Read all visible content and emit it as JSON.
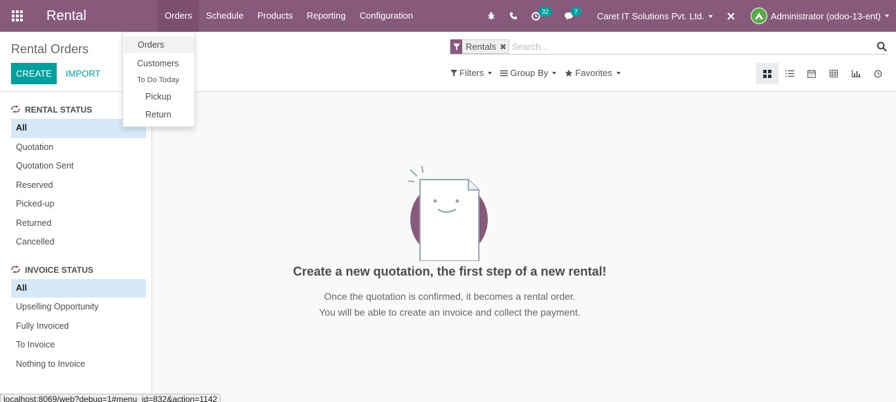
{
  "navbar": {
    "brand": "Rental",
    "menu": [
      "Orders",
      "Schedule",
      "Products",
      "Reporting",
      "Configuration"
    ],
    "activities_count": "32",
    "messages_count": "7",
    "company": "Caret IT Solutions Pvt. Ltd.",
    "user": "Administrator (odoo-13-ent)"
  },
  "control_panel": {
    "breadcrumb": "Rental Orders",
    "create_label": "Create",
    "import_label": "Import",
    "facet_label": "Rentals",
    "search_placeholder": "Search...",
    "filters_label": "Filters",
    "groupby_label": "Group By",
    "favorites_label": "Favorites"
  },
  "sidebar": {
    "rental_status": {
      "header": "Rental Status",
      "items": [
        "All",
        "Quotation",
        "Quotation Sent",
        "Reserved",
        "Picked-up",
        "Returned",
        "Cancelled"
      ]
    },
    "invoice_status": {
      "header": "Invoice Status",
      "items": [
        "All",
        "Upselling Opportunity",
        "Fully Invoiced",
        "To Invoice",
        "Nothing to Invoice"
      ]
    }
  },
  "helper": {
    "title": "Create a new quotation, the first step of a new rental!",
    "line1": "Once the quotation is confirmed, it becomes a rental order.",
    "line2": "You will be able to create an invoice and collect the payment."
  },
  "dropdown": {
    "orders": "Orders",
    "customers": "Customers",
    "section_header": "To Do Today",
    "pickup": "Pickup",
    "return": "Return"
  },
  "status_url": "localhost:8069/web?debug=1#menu_id=832&action=1142",
  "colors": {
    "brand": "#875a7b",
    "accent": "#00a09d",
    "selected_bg": "#d7e9f8"
  }
}
